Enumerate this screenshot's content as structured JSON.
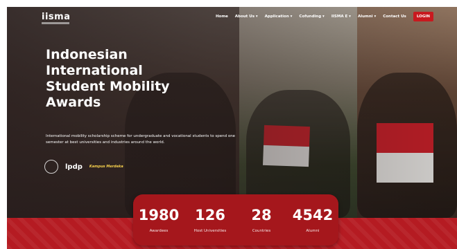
{
  "header": {
    "logo": "iisma",
    "nav": [
      "Home",
      "About Us ▾",
      "Application ▾",
      "Cofunding ▾",
      "IISMA E ▾",
      "Alumni ▾",
      "Contact Us"
    ],
    "login": "LOGIN"
  },
  "hero": {
    "title_lines": [
      "Indonesian",
      "International",
      "Student Mobility",
      "Awards"
    ],
    "subtitle": "International mobility scholarship scheme for undergraduate and vocational students to spend one semester at best universities and industries around the world.",
    "partners": [
      "lpdp",
      "Kampus Merdeka"
    ]
  },
  "stats": [
    {
      "value": "1980",
      "label": "Awardees"
    },
    {
      "value": "126",
      "label": "Host Universities"
    },
    {
      "value": "28",
      "label": "Countries"
    },
    {
      "value": "4542",
      "label": "Alumni"
    }
  ],
  "colors": {
    "accent": "#c8191f",
    "band": "#b51b22"
  }
}
